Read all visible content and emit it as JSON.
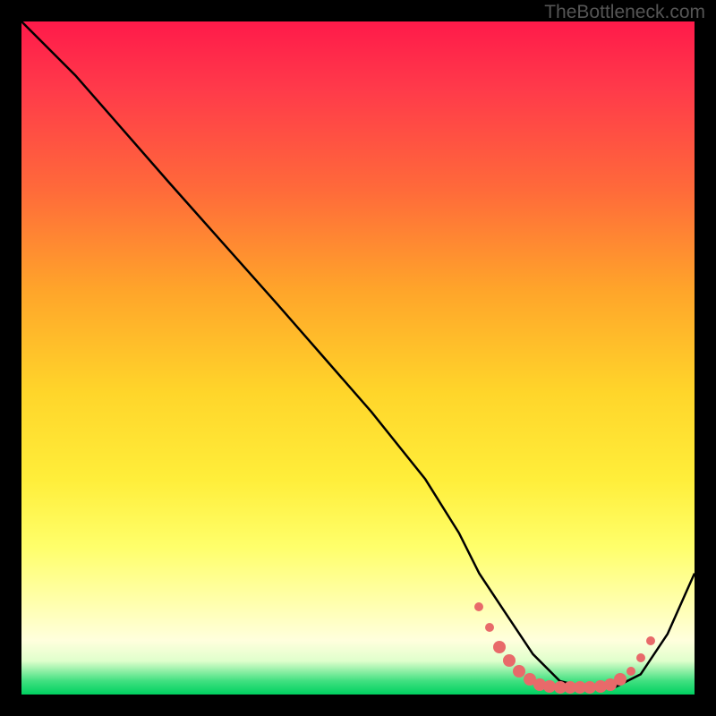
{
  "watermark": "TheBottleneck.com",
  "chart_data": {
    "type": "line",
    "title": "",
    "xlabel": "",
    "ylabel": "",
    "xlim": [
      0,
      100
    ],
    "ylim": [
      0,
      100
    ],
    "series": [
      {
        "name": "curve",
        "x": [
          0,
          8,
          15,
          22,
          30,
          38,
          45,
          52,
          60,
          65,
          68,
          72,
          76,
          80,
          84,
          88,
          92,
          96,
          100
        ],
        "y": [
          100,
          92,
          84,
          76,
          67,
          58,
          50,
          42,
          32,
          24,
          18,
          12,
          6,
          2,
          1,
          1,
          3,
          9,
          18
        ]
      }
    ],
    "markers": [
      {
        "x": 68.0,
        "y": 13.0,
        "size": "sm"
      },
      {
        "x": 69.5,
        "y": 10.0,
        "size": "sm"
      },
      {
        "x": 71.0,
        "y": 7.0
      },
      {
        "x": 72.5,
        "y": 5.0
      },
      {
        "x": 74.0,
        "y": 3.5
      },
      {
        "x": 75.5,
        "y": 2.2
      },
      {
        "x": 77.0,
        "y": 1.5
      },
      {
        "x": 78.5,
        "y": 1.2
      },
      {
        "x": 80.0,
        "y": 1.0
      },
      {
        "x": 81.5,
        "y": 1.0
      },
      {
        "x": 83.0,
        "y": 1.0
      },
      {
        "x": 84.5,
        "y": 1.0
      },
      {
        "x": 86.0,
        "y": 1.2
      },
      {
        "x": 87.5,
        "y": 1.5
      },
      {
        "x": 89.0,
        "y": 2.2
      },
      {
        "x": 90.5,
        "y": 3.5,
        "size": "sm"
      },
      {
        "x": 92.0,
        "y": 5.5,
        "size": "sm"
      },
      {
        "x": 93.5,
        "y": 8.0,
        "size": "sm"
      }
    ],
    "gradient_stops": [
      {
        "pos": 0,
        "color": "#ff1a4a"
      },
      {
        "pos": 25,
        "color": "#ff6a3a"
      },
      {
        "pos": 55,
        "color": "#ffd52a"
      },
      {
        "pos": 86,
        "color": "#ffffaa"
      },
      {
        "pos": 100,
        "color": "#00d060"
      }
    ]
  }
}
